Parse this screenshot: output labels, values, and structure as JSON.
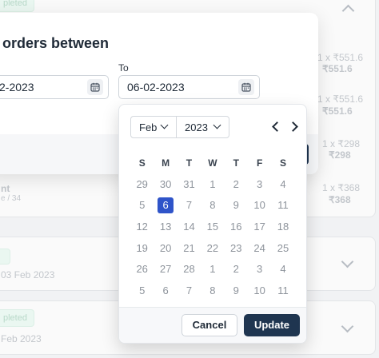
{
  "orders": {
    "top_badge": "pleted",
    "items": [
      {
        "price_small": "1 x ₹551.6",
        "price": "₹551.6"
      },
      {
        "price_small": "1 x ₹551.6",
        "price": "₹551.6"
      },
      {
        "price_small": "1 x ₹298",
        "price": "₹298"
      },
      {
        "price_small": "1 x ₹368",
        "price": "₹368"
      }
    ],
    "row_name_fragment": "nt",
    "row_sub_fragment": "e / 34",
    "card2_date": "03 Feb 2023",
    "card3_badge": "pleted",
    "card3_date": "Feb 2023"
  },
  "modal": {
    "title": "orders between",
    "from_value": "2-2023",
    "to_label": "To",
    "to_value": "06-02-2023"
  },
  "picker": {
    "month": "Feb",
    "year": "2023",
    "weekdays": [
      "S",
      "M",
      "T",
      "W",
      "T",
      "F",
      "S"
    ],
    "weeks": [
      [
        "29",
        "30",
        "31",
        "1",
        "2",
        "3",
        "4"
      ],
      [
        "5",
        "6",
        "7",
        "8",
        "9",
        "10",
        "11"
      ],
      [
        "12",
        "13",
        "14",
        "15",
        "16",
        "17",
        "18"
      ],
      [
        "19",
        "20",
        "21",
        "22",
        "23",
        "24",
        "25"
      ],
      [
        "26",
        "27",
        "28",
        "1",
        "2",
        "3",
        "4"
      ],
      [
        "5",
        "6",
        "7",
        "8",
        "9",
        "10",
        "11"
      ]
    ],
    "selected_day": "6",
    "cancel_label": "Cancel",
    "update_label": "Update"
  }
}
